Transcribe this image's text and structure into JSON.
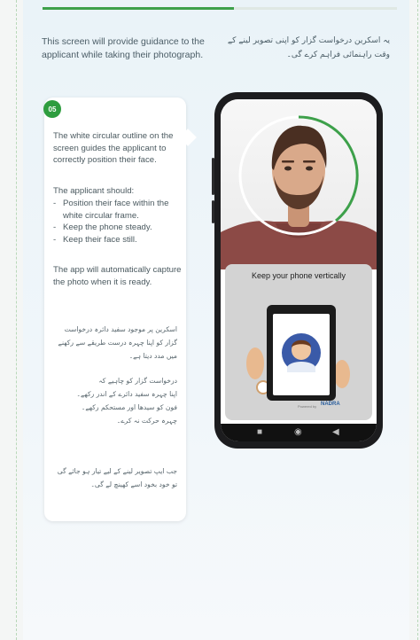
{
  "progress": {
    "fraction": 0.54,
    "color": "#3da04a"
  },
  "intro": {
    "en": "This screen will provide guidance to the applicant while taking their photograph.",
    "ur": "یہ اسکرین درخواست گزار کو اپنی تصویر لینے کے وقت راہنمائی فراہم کرے گی۔"
  },
  "card": {
    "step_number": "05",
    "paragraph1": "The white circular outline on the screen guides the applicant to correctly position their face.",
    "paragraph2": "The applicant should:",
    "list": [
      "Position their face within the white circular frame.",
      "Keep the phone steady.",
      "Keep their face still."
    ],
    "paragraph3": "The app will automatically capture the photo when it is ready.",
    "ur_paragraph1": "اسکرین پر موجود سفید دائرہ درخواست گزار کو اپنا چہرہ درست طریقے سے رکھنے میں مدد دیتا ہے۔",
    "ur_paragraph2_lines": [
      "درخواست گزار کو چاہیے کہ",
      "اپنا چہرہ سفید دائرے کے اندر رکھے۔",
      "فون کو سیدھا اور مستحکم رکھے۔",
      "چہرہ حرکت نہ کرے۔"
    ],
    "ur_paragraph3": "جب ایپ تصویر لینے کے لیے تیار ہو جائے گی تو خود بخود اسے کھینچ لے گی۔"
  },
  "phone": {
    "instruction": "Keep your phone vertically",
    "powered_by": "Powered by",
    "brand": "NADRA"
  },
  "colors": {
    "accent": "#2e9d3f",
    "panel": "#eaf3f8"
  }
}
